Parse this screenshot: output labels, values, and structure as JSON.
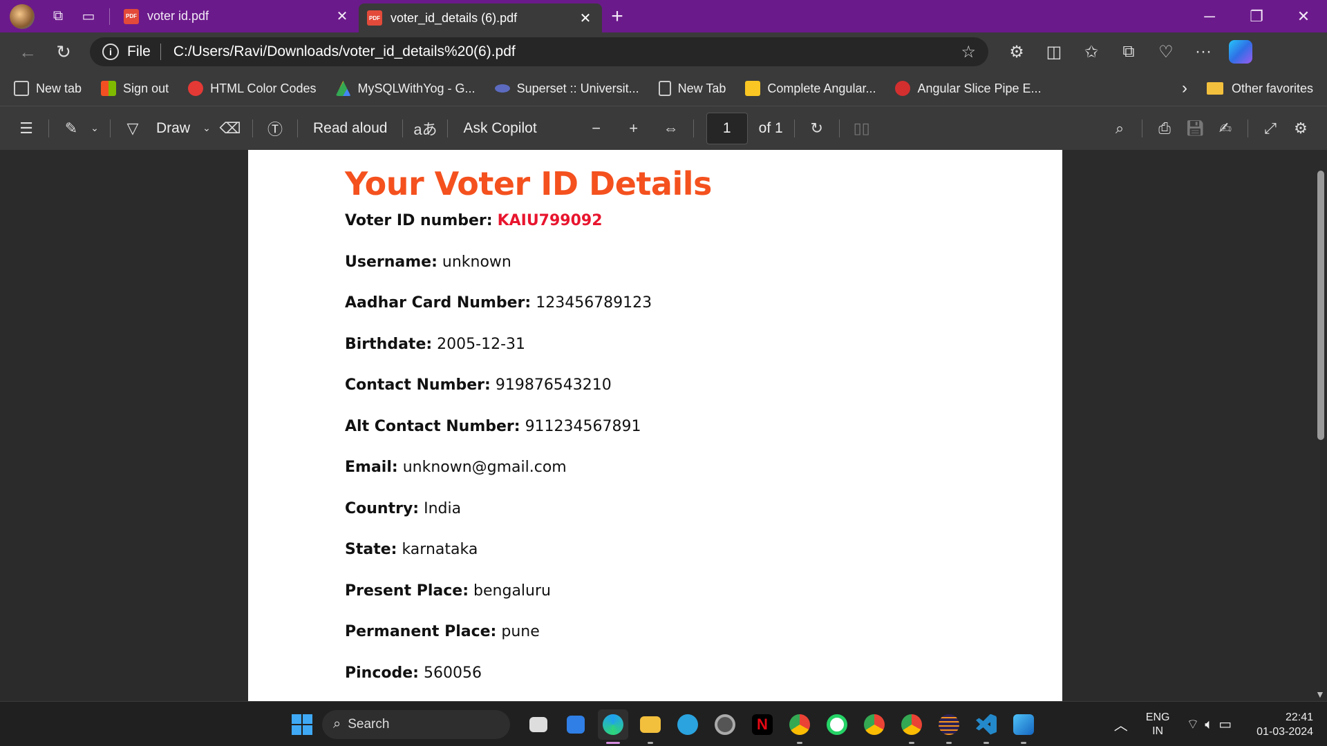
{
  "tabs": [
    {
      "title": "voter id.pdf",
      "active": false
    },
    {
      "title": "voter_id_details (6).pdf",
      "active": true
    }
  ],
  "address": {
    "scheme": "File",
    "url": "C:/Users/Ravi/Downloads/voter_id_details%20(6).pdf"
  },
  "favorites": [
    {
      "label": "New tab",
      "color": "#cfcfcf"
    },
    {
      "label": "Sign out",
      "color": "#f25022"
    },
    {
      "label": "HTML Color Codes",
      "color": "#e53935"
    },
    {
      "label": "MySQLWithYog - G...",
      "color": "#43a047"
    },
    {
      "label": "Superset :: Universit...",
      "color": "#5c6bc0"
    },
    {
      "label": "New Tab",
      "color": "#cfcfcf"
    },
    {
      "label": "Complete Angular...",
      "color": "#f9c623"
    },
    {
      "label": "Angular Slice Pipe E...",
      "color": "#d32f2f"
    }
  ],
  "favorites_other": "Other favorites",
  "pdf_toolbar": {
    "draw": "Draw",
    "read_aloud": "Read aloud",
    "ask_copilot": "Ask Copilot",
    "page_current": "1",
    "page_total": "of 1"
  },
  "document": {
    "title": "Your Voter ID Details",
    "fields": [
      {
        "label": "Voter ID number:",
        "value": "KAIU799092",
        "highlight": true
      },
      {
        "label": "Username:",
        "value": "unknown"
      },
      {
        "label": "Aadhar Card Number:",
        "value": "123456789123"
      },
      {
        "label": "Birthdate:",
        "value": "2005-12-31"
      },
      {
        "label": "Contact Number:",
        "value": "919876543210"
      },
      {
        "label": "Alt Contact Number:",
        "value": "911234567891"
      },
      {
        "label": "Email:",
        "value": "unknown@gmail.com"
      },
      {
        "label": "Country:",
        "value": "India"
      },
      {
        "label": "State:",
        "value": "karnataka"
      },
      {
        "label": "Present Place:",
        "value": "bengaluru"
      },
      {
        "label": "Permanent Place:",
        "value": "pune"
      },
      {
        "label": "Pincode:",
        "value": "560056"
      }
    ]
  },
  "taskbar": {
    "search_label": "Search",
    "lang_line1": "ENG",
    "lang_line2": "IN",
    "time": "22:41",
    "date": "01-03-2024"
  },
  "colors": {
    "title_accent": "#f4511e",
    "voter_id_red": "#e8152e",
    "tabstrip_purple": "#6b1a8b"
  }
}
